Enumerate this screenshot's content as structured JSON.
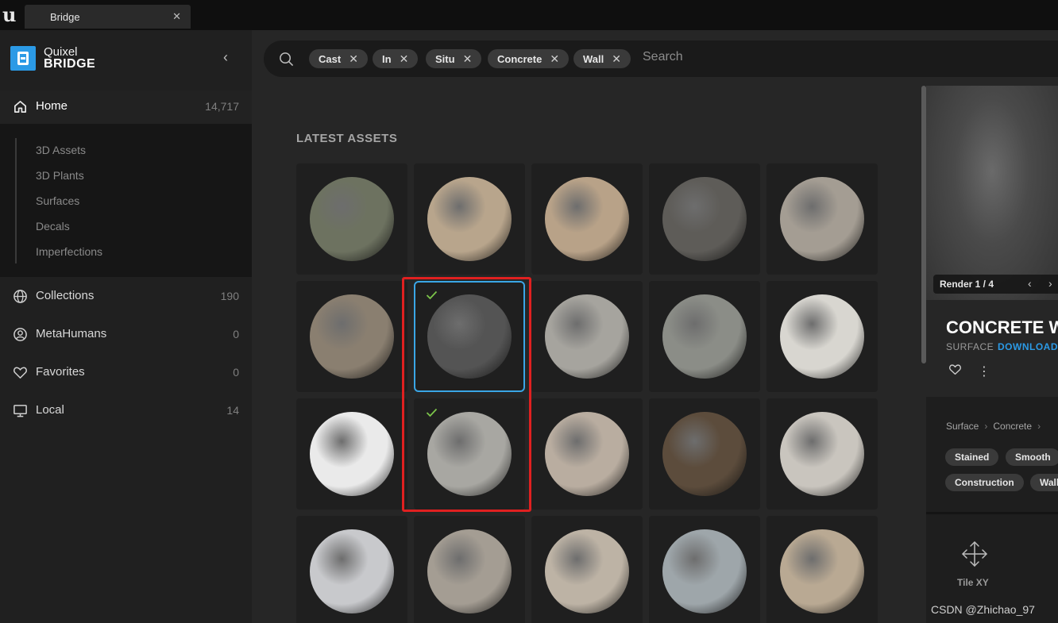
{
  "window": {
    "tab_title": "Bridge",
    "tab_close": "✕"
  },
  "sidebar": {
    "brand_line1": "Quixel",
    "brand_line2": "BRIDGE",
    "collapse_icon": "‹",
    "home": {
      "label": "Home",
      "count": "14,717"
    },
    "sub_items": [
      "3D Assets",
      "3D Plants",
      "Surfaces",
      "Decals",
      "Imperfections"
    ],
    "items": [
      {
        "label": "Collections",
        "count": "190",
        "icon": "globe-icon"
      },
      {
        "label": "MetaHumans",
        "count": "0",
        "icon": "person-icon"
      },
      {
        "label": "Favorites",
        "count": "0",
        "icon": "heart-icon"
      },
      {
        "label": "Local",
        "count": "14",
        "icon": "monitor-icon"
      }
    ]
  },
  "search": {
    "chips": [
      "Cast",
      "In",
      "Situ",
      "Concrete",
      "Wall"
    ],
    "chip_close": "✕",
    "placeholder": "Search"
  },
  "main": {
    "section_title": "LATEST ASSETS"
  },
  "assets": [
    {
      "color": "#6d7260",
      "selected": false,
      "checked": false
    },
    {
      "color": "#b8a58c",
      "selected": false,
      "checked": false
    },
    {
      "color": "#b8a288",
      "selected": false,
      "checked": false
    },
    {
      "color": "#5e5c58",
      "selected": false,
      "checked": false
    },
    {
      "color": "#a49d93",
      "selected": false,
      "checked": false
    },
    {
      "color": "#8a7f70",
      "selected": false,
      "checked": false
    },
    {
      "color": "#545454",
      "selected": true,
      "checked": true
    },
    {
      "color": "#a6a49e",
      "selected": false,
      "checked": false
    },
    {
      "color": "#8b8d87",
      "selected": false,
      "checked": false
    },
    {
      "color": "#d8d6d0",
      "selected": false,
      "checked": false
    },
    {
      "color": "#eaeaea",
      "selected": false,
      "checked": false
    },
    {
      "color": "#a8a7a2",
      "selected": false,
      "checked": true
    },
    {
      "color": "#b9ada0",
      "selected": false,
      "checked": false
    },
    {
      "color": "#5c4c3c",
      "selected": false,
      "checked": false
    },
    {
      "color": "#c9c5be",
      "selected": false,
      "checked": false
    },
    {
      "color": "#c8c9cc",
      "selected": false,
      "checked": false
    },
    {
      "color": "#a49d93",
      "selected": false,
      "checked": false
    },
    {
      "color": "#bdb3a5",
      "selected": false,
      "checked": false
    },
    {
      "color": "#9ea6aa",
      "selected": false,
      "checked": false
    },
    {
      "color": "#b9a993",
      "selected": false,
      "checked": false
    }
  ],
  "detail": {
    "render_label": "Render 1 / 4",
    "prev": "‹",
    "next": "›",
    "title": "CONCRETE WA",
    "type": "SURFACE",
    "download": "DOWNLOADE",
    "breadcrumb": [
      "Surface",
      "Concrete"
    ],
    "breadcrumb_sep": "›",
    "tags": [
      "Stained",
      "Smooth",
      "Construction",
      "Wall"
    ],
    "tile_label": "Tile XY",
    "kebab": "⋮"
  },
  "watermark": "CSDN @Zhichao_97",
  "colors": {
    "accent": "#2b9ae6",
    "selection": "#3aa6e6",
    "highlight": "#e02020",
    "check": "#7cc54a"
  }
}
